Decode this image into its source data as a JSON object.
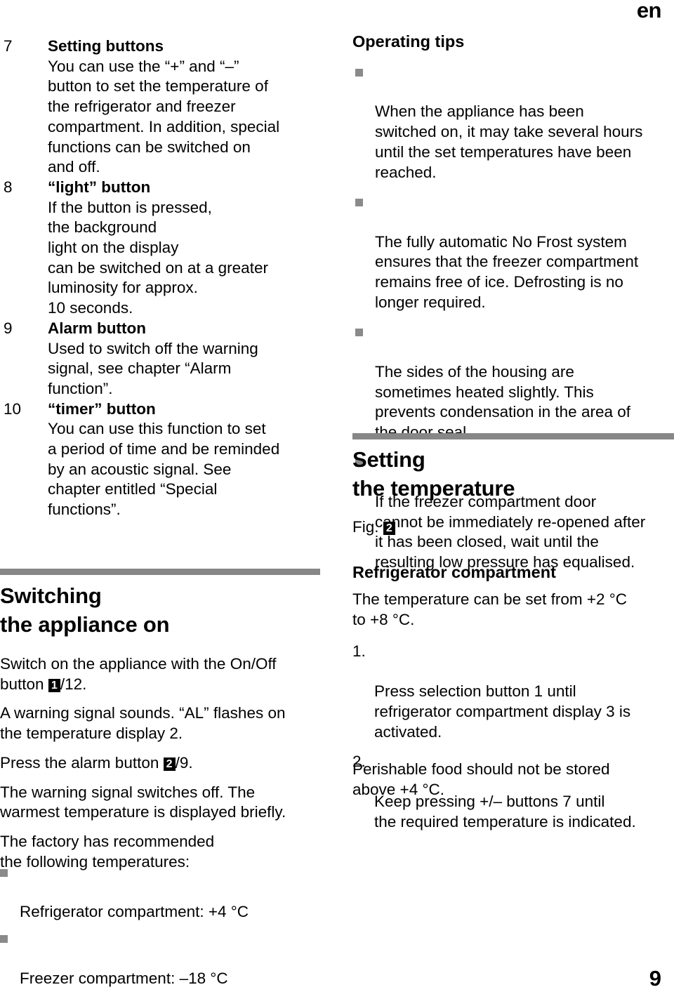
{
  "page": {
    "language_marker": "en",
    "page_number": "9"
  },
  "left_column": {
    "numbered_items": [
      {
        "number": "7",
        "term": "Setting buttons",
        "description": "You can use the “+” and “–”\nbutton to set the temperature of\nthe refrigerator and freezer\ncompartment. In addition, special\nfunctions can be switched on\nand off."
      },
      {
        "number": "8",
        "term": "“light” button",
        "description": "If the button is pressed,\nthe background\nlight on the display\ncan be switched on at a greater\nluminosity for approx.\n10 seconds."
      },
      {
        "number": "9",
        "term": "Alarm button",
        "description": "Used to switch off the warning\nsignal, see chapter “Alarm\nfunction”."
      },
      {
        "number": "10",
        "term": "“timer” button",
        "description": "You can use this function to set\na period of time and be reminded\nby an acoustic signal. See\nchapter entitled “Special\nfunctions”."
      }
    ],
    "switching_section": {
      "title": "Switching\nthe appliance on",
      "paragraph_1_before_mark": "Switch on the appliance with the On/Off\nbutton ",
      "paragraph_1_mark": "1",
      "paragraph_1_after_mark": "/12.",
      "paragraph_2": "A warning signal sounds. “AL” flashes on\nthe temperature display 2.",
      "paragraph_3_before_mark": "Press the alarm button ",
      "paragraph_3_mark": "2",
      "paragraph_3_after_mark": "/9.",
      "paragraph_4": "The warning signal switches off. The\nwarmest temperature is displayed briefly.",
      "paragraph_5": "The factory has recommended\nthe following temperatures:",
      "recommended_temperatures": [
        "Refrigerator compartment: +4 °C",
        "Freezer compartment:  –18 °C"
      ]
    }
  },
  "right_column": {
    "operating_tips": {
      "heading": "Operating tips",
      "bullets": [
        "When the appliance has been\nswitched on, it may take several hours\nuntil the set temperatures have been\nreached.",
        "The fully automatic No Frost system\nensures that the freezer compartment\nremains free of ice. Defrosting is no\nlonger required.",
        "The sides of the housing are\nsometimes heated slightly. This\nprevents condensation in the area of\nthe door seal.",
        "If the freezer compartment door\ncannot be immediately re-opened after\nit has been closed, wait until the\nresulting low pressure has equalised."
      ]
    },
    "setting_temperature": {
      "title": "Setting\nthe temperature",
      "figure_label": "Fig.",
      "figure_mark": "2",
      "subheading": "Refrigerator compartment",
      "range_paragraph": "The temperature can be set from +2 °C\nto +8 °C.",
      "steps": [
        {
          "number": "1.",
          "text": "Press selection button 1 until\nrefrigerator compartment display 3 is\nactivated."
        },
        {
          "number": "2.",
          "text": "Keep pressing +/– buttons 7 until\nthe required temperature is indicated."
        }
      ],
      "note": "Perishable food should not be stored\nabove +4 °C."
    }
  },
  "colors": {
    "rule_gray": "#878787",
    "bullet_gray": "#8a8a8a",
    "text_black": "#000000",
    "mark_bg": "#000000"
  }
}
